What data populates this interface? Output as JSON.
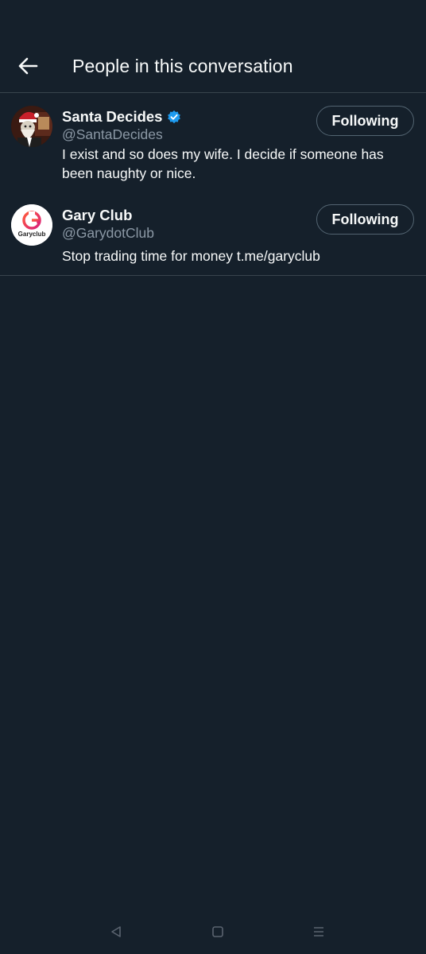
{
  "header": {
    "title": "People in this conversation",
    "back_icon": "arrow-left-icon"
  },
  "users": [
    {
      "display_name": "Santa Decides",
      "verified": true,
      "handle": "@SantaDecides",
      "bio": "I exist and so does my wife. I decide if someone has been naughty or nice.",
      "follow_label": "Following",
      "avatar_icon": "santa-avatar"
    },
    {
      "display_name": "Gary Club",
      "verified": false,
      "handle": "@GarydotClub",
      "bio": "Stop trading time for money t.me/garyclub",
      "follow_label": "Following",
      "avatar_icon": "gary-club-logo",
      "avatar_text": "Garyclub"
    }
  ],
  "system_nav": {
    "back_icon": "triangle-back-icon",
    "home_icon": "square-home-icon",
    "recents_icon": "menu-lines-icon"
  },
  "colors": {
    "background": "#15202b",
    "text_primary": "#f7f9f9",
    "text_secondary": "#8b98a5",
    "border": "#38444d",
    "verified_blue": "#1d9bf0"
  }
}
